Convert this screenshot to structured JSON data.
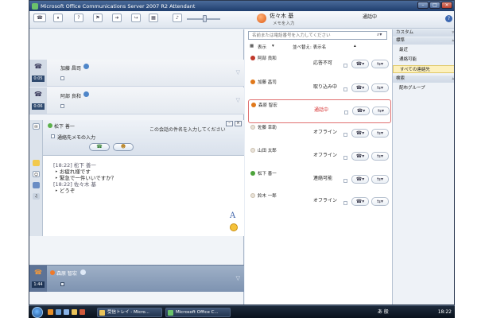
{
  "window": {
    "title": "Microsoft Office Communications Server 2007 R2 Attendant",
    "min_glyph": "–",
    "max_glyph": "□",
    "close_glyph": "×"
  },
  "self": {
    "name": "佐々木 基",
    "note": "メモを入力",
    "status": "通話中",
    "help_glyph": "?"
  },
  "call_queue": [
    {
      "name": "加藤 昌司",
      "timer": "0:05"
    },
    {
      "name": "阿部 良和",
      "timer": "0:06"
    }
  ],
  "conversation": {
    "contact_name": "松下 善一",
    "subject_placeholder": "この会話の件名を入力してください",
    "note_label": "通絡先メモの入力",
    "messages": [
      {
        "header": "[18:22] 松下 善一",
        "lines": [
          "お疲れ様です",
          "緊急で一件いいですか？"
        ]
      },
      {
        "header": "[18:22] 佐々木 基",
        "lines": [
          "どうぞ"
        ]
      }
    ],
    "font_glyph": "A"
  },
  "active_call": {
    "name": "森原 智宏",
    "timer": "1:44"
  },
  "contacts": {
    "search_placeholder": "名前または電話番号を入力してください",
    "view_label": "表示",
    "sort_label": "並べ替え: 表示名",
    "items": [
      {
        "name": "阿部 良和",
        "status": "応答不可",
        "status_color": "#222222",
        "dot_color": "#c0392b",
        "selected": false
      },
      {
        "name": "加藤 昌司",
        "status": "取り込み中",
        "status_color": "#222222",
        "dot_color": "#e0781a",
        "selected": false
      },
      {
        "name": "森原 智宏",
        "status": "通話中",
        "status_color": "#d62f2f",
        "dot_color": "#e0781a",
        "selected": true
      },
      {
        "name": "佐藤 幸助",
        "status": "オフライン",
        "status_color": "#222222",
        "dot_color": "#e8e2d8",
        "selected": false
      },
      {
        "name": "山田 太郎",
        "status": "オフライン",
        "status_color": "#222222",
        "dot_color": "#e8e2d8",
        "selected": false
      },
      {
        "name": "松下 善一",
        "status": "連絡可能",
        "status_color": "#222222",
        "dot_color": "#4ca33a",
        "selected": false
      },
      {
        "name": "鈴木 一郎",
        "status": "オフライン",
        "status_color": "#222222",
        "dot_color": "#e8e2d8",
        "selected": false
      }
    ]
  },
  "groups": {
    "sections": [
      {
        "header": "カスタム",
        "items": []
      },
      {
        "header": "標準",
        "items": [
          "最近",
          "通絡可能",
          "すべての連絡先"
        ]
      },
      {
        "header": "検索",
        "items": [
          "配布グループ"
        ]
      }
    ],
    "selected_item": "すべての連絡先"
  },
  "taskbar": {
    "buttons": [
      "受信トレイ - Micro...",
      "Microsoft Office C..."
    ],
    "tray_text": "あ 般",
    "clock": "18:22"
  },
  "colors": {
    "accent": "#2b4f86",
    "busy": "#e0781a",
    "available": "#4ca33a",
    "dnd": "#c0392b"
  }
}
